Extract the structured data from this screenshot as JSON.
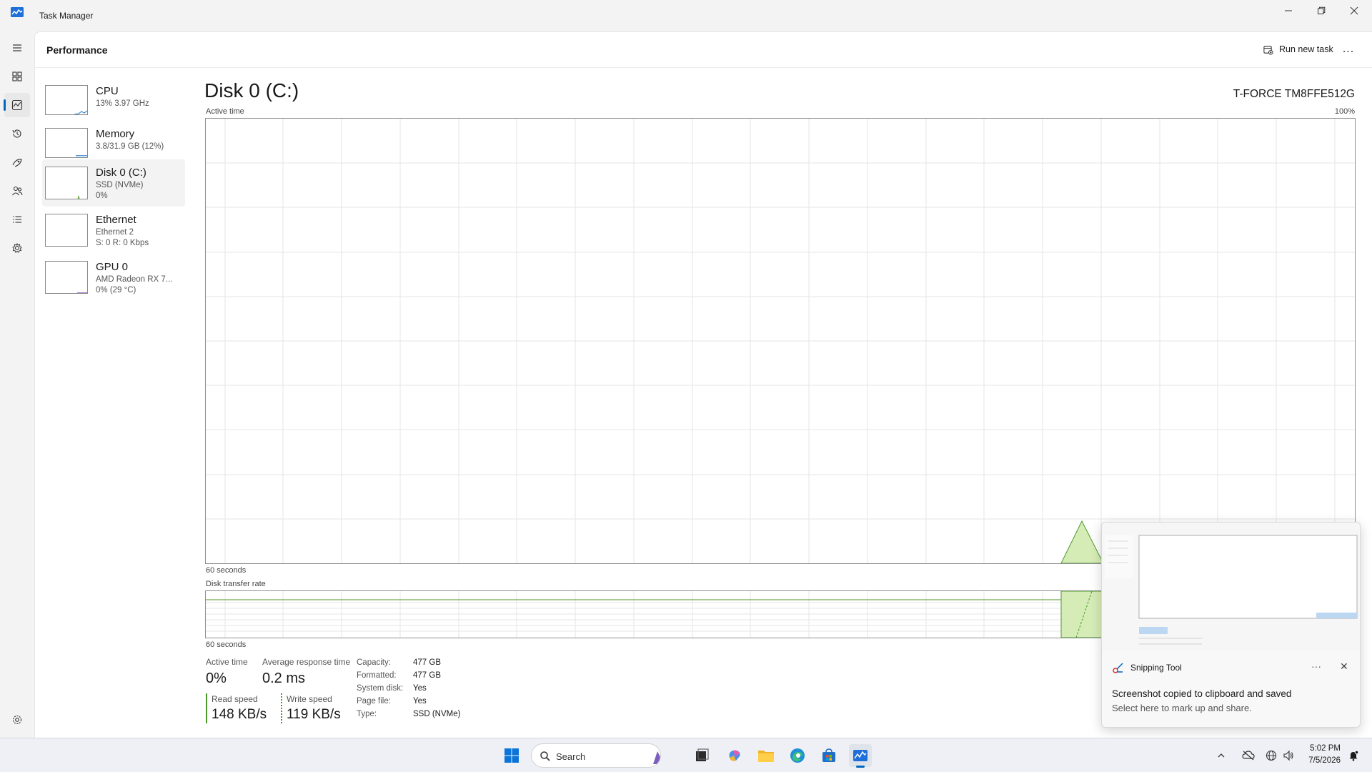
{
  "window": {
    "title": "Task Manager",
    "minimize_icon": "minimize-icon",
    "maximize_icon": "restore-icon",
    "close_icon": "close-icon"
  },
  "nav": {
    "items": [
      {
        "name": "menu",
        "icon": "hamburger-icon"
      },
      {
        "name": "processes",
        "icon": "processes-icon"
      },
      {
        "name": "performance",
        "icon": "performance-icon",
        "active": true
      },
      {
        "name": "app-history",
        "icon": "history-icon"
      },
      {
        "name": "startup-apps",
        "icon": "startup-icon"
      },
      {
        "name": "users",
        "icon": "users-icon"
      },
      {
        "name": "details",
        "icon": "details-icon"
      },
      {
        "name": "services",
        "icon": "services-icon"
      },
      {
        "name": "settings",
        "icon": "gear-icon"
      }
    ]
  },
  "header": {
    "title": "Performance",
    "run_new_task": "Run new task",
    "more": "..."
  },
  "sidebar": {
    "tiles": [
      {
        "title": "CPU",
        "line1": "13% 3.97 GHz",
        "line2": "",
        "color": "#1f78c8",
        "selected": false
      },
      {
        "title": "Memory",
        "line1": "3.8/31.9 GB (12%)",
        "line2": "",
        "color": "#1f78c8",
        "selected": false
      },
      {
        "title": "Disk 0 (C:)",
        "line1": "SSD (NVMe)",
        "line2": "0%",
        "color": "#4c9a2a",
        "selected": true
      },
      {
        "title": "Ethernet",
        "line1": "Ethernet 2",
        "line2": "S: 0 R: 0 Kbps",
        "color": "#a56a1f",
        "selected": false
      },
      {
        "title": "GPU 0",
        "line1": "AMD Radeon RX 7...",
        "line2": "0% (29 °C)",
        "color": "#8a3fc8",
        "selected": false
      }
    ]
  },
  "detail": {
    "title": "Disk 0 (C:)",
    "model": "T-FORCE TM8FFE512G",
    "active_time_label": "Active time",
    "max_label": "100%",
    "seconds_label_1": "60 seconds",
    "transfer_label": "Disk transfer rate",
    "seconds_label_2": "60 seconds",
    "accent": "#4c9a2a",
    "fill": "#d6ecb7",
    "stats": {
      "active_time": {
        "label": "Active time",
        "value": "0%"
      },
      "avg_response": {
        "label": "Average response time",
        "value": "0.2 ms"
      },
      "read_speed": {
        "label": "Read speed",
        "value": "148 KB/s"
      },
      "write_speed": {
        "label": "Write speed",
        "value": "119 KB/s"
      }
    },
    "properties": [
      {
        "label": "Capacity:",
        "value": "477 GB"
      },
      {
        "label": "Formatted:",
        "value": "477 GB"
      },
      {
        "label": "System disk:",
        "value": "Yes"
      },
      {
        "label": "Page file:",
        "value": "Yes"
      },
      {
        "label": "Type:",
        "value": "SSD (NVMe)"
      }
    ]
  },
  "toast": {
    "app": "Snipping Tool",
    "message": "Screenshot copied to clipboard and saved",
    "sub": "Select here to mark up and share.",
    "more": "···",
    "close": "✕"
  },
  "taskbar": {
    "search_placeholder": "Search",
    "time": "5:02 PM",
    "date": "7/5/2026"
  }
}
